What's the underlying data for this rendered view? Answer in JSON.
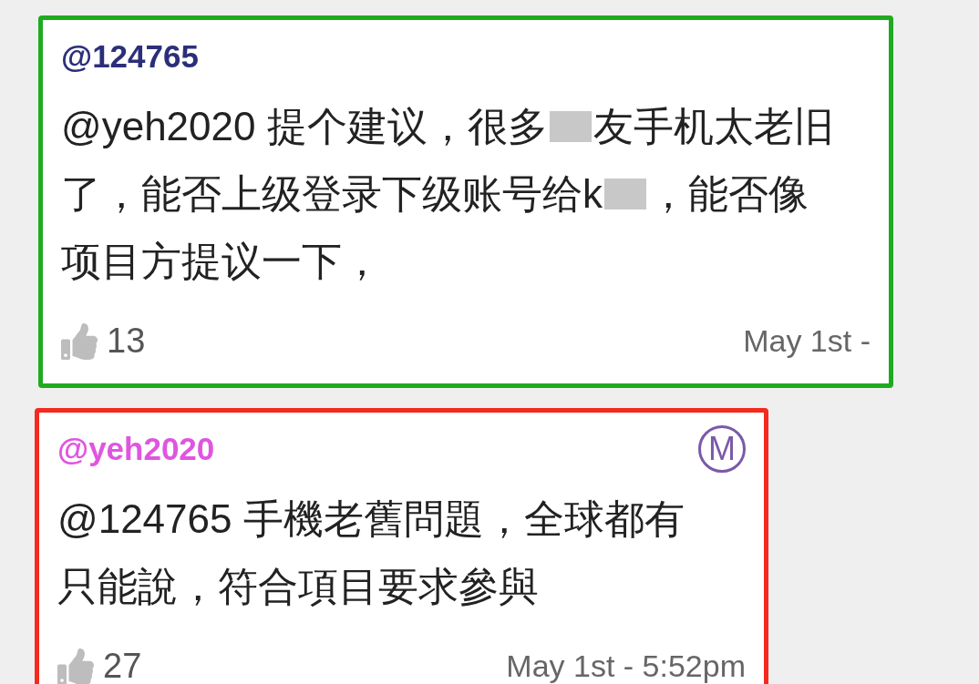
{
  "comments": [
    {
      "author": "@124765",
      "kind": "member",
      "color": "#1faa1f",
      "lines": [
        [
          "@yeh2020 提个建议，很多",
          "友手机太老旧"
        ],
        [
          "了，能否上级登录下级账号给k",
          "，能否像"
        ],
        [
          "项目方提议一下，"
        ]
      ],
      "likes": "13",
      "time": "May 1st -"
    },
    {
      "author": "@yeh2020",
      "kind": "moderator",
      "color": "#f52a1e",
      "badge": "M",
      "lines": [
        [
          "@124765 手機老舊問題，全球都有"
        ],
        [
          "只能說，符合項目要求參與"
        ]
      ],
      "likes": "27",
      "time": "May 1st - 5:52pm"
    }
  ]
}
